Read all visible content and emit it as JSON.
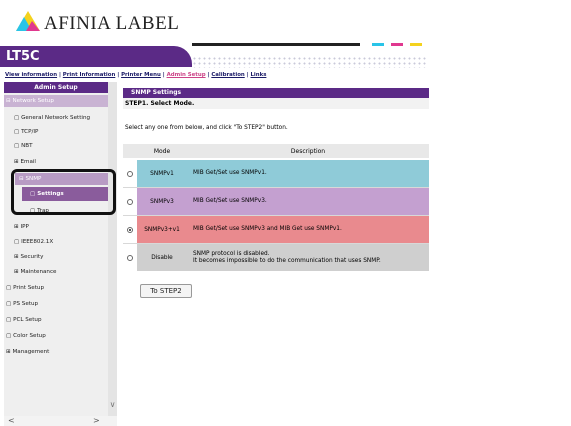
{
  "header": {
    "brand": "AFINIA LABEL",
    "model": "LT5C"
  },
  "colors": {
    "brand_purple": "#5b2a86",
    "stripe_cyan": "#29c4e8",
    "stripe_magenta": "#e0388f",
    "stripe_yellow": "#f4d21e",
    "row_blue": "#8fcbd8",
    "row_purple": "#c4a0d0",
    "row_red": "#e98a8e",
    "row_gray": "#cfcfcf"
  },
  "nav": {
    "items": [
      "View information",
      "Print Information",
      "Printer Menu",
      "Admin Setup",
      "Calibration",
      "Links"
    ],
    "separator": " | ",
    "active": "Admin Setup"
  },
  "sidebar": {
    "title": "Admin Setup",
    "items": [
      {
        "label": "Network Setup",
        "marker": "⊟"
      },
      {
        "label": "General Network Setting",
        "marker": "▢"
      },
      {
        "label": "TCP/IP",
        "marker": "▢"
      },
      {
        "label": "NBT",
        "marker": "▢"
      },
      {
        "label": "Email",
        "marker": "⊞"
      },
      {
        "label": "SNMP",
        "marker": "⊟"
      },
      {
        "label": "Settings",
        "marker": "▢"
      },
      {
        "label": "Trap",
        "marker": "▢"
      },
      {
        "label": "IPP",
        "marker": "⊞"
      },
      {
        "label": "IEEE802.1X",
        "marker": "▢"
      },
      {
        "label": "Security",
        "marker": "⊞"
      },
      {
        "label": "Maintenance",
        "marker": "⊞"
      },
      {
        "label": "Print Setup",
        "marker": "▢"
      },
      {
        "label": "PS Setup",
        "marker": "▢"
      },
      {
        "label": "PCL Setup",
        "marker": "▢"
      },
      {
        "label": "Color Setup",
        "marker": "▢"
      },
      {
        "label": "Management",
        "marker": "⊞"
      }
    ],
    "scroll_left": "<",
    "scroll_right": ">",
    "scroll_down": "∨"
  },
  "main": {
    "section_title": "SNMP Settings",
    "step_title": "STEP1. Select Mode.",
    "instruction": "Select any one from below, and click \"To STEP2\" button.",
    "columns": {
      "mode": "Mode",
      "description": "Description"
    },
    "rows": [
      {
        "mode": "SNMPv1",
        "description": "MIB Get/Set use SNMPv1.",
        "selected": false
      },
      {
        "mode": "SNMPv3",
        "description": "MIB Get/Set use SNMPv3.",
        "selected": false
      },
      {
        "mode": "SNMPv3+v1",
        "description": "MIB Get/Set use SNMPv3 and MIB Get use SNMPv1.",
        "selected": true
      },
      {
        "mode": "Disable",
        "description": "SNMP protocol is disabled.",
        "description2": "It becomes impossible to do the communication that uses SNMP.",
        "selected": false
      }
    ],
    "button_label": "To STEP2"
  }
}
